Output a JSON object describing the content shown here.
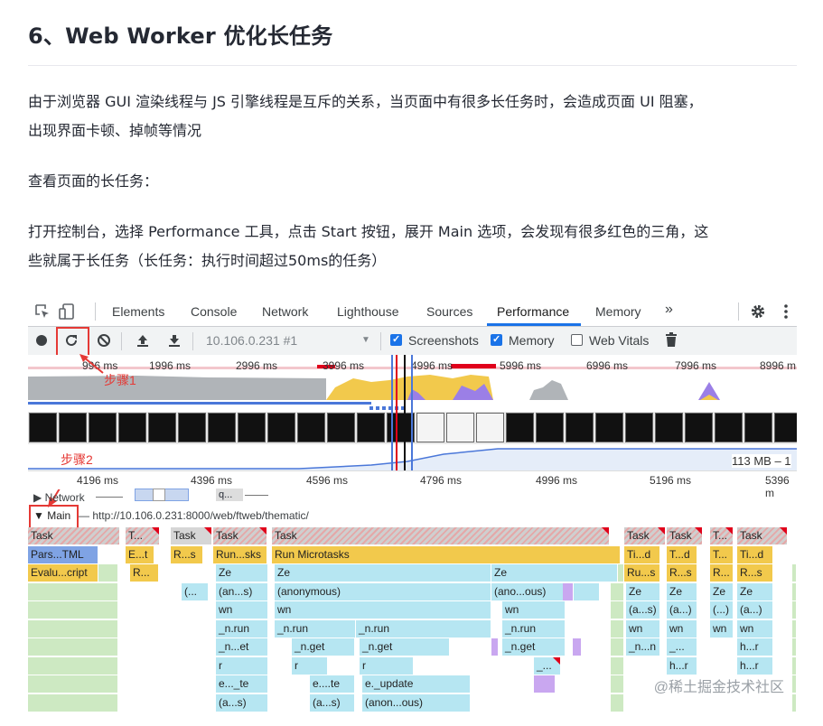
{
  "article": {
    "heading": "6、Web Worker 优化长任务",
    "para1_line1": "由于浏览器 GUI 渲染线程与 JS 引擎线程是互斥的关系，当页面中有很多长任务时，会造成页面 UI 阻塞，",
    "para1_line2": "出现界面卡顿、掉帧等情况",
    "para2": "查看页面的长任务：",
    "para3_line1": "打开控制台，选择 Performance 工具，点击 Start 按钮，展开 Main 选项，会发现有很多红色的三角，这",
    "para3_line2": "些就属于长任务（长任务：执行时间超过50ms的任务）"
  },
  "devtools": {
    "tabs": [
      "Elements",
      "Console",
      "Network",
      "Lighthouse",
      "Sources",
      "Performance",
      "Memory"
    ],
    "active_tab": "Performance",
    "more_tabs": "»",
    "icons": {
      "inspect": "inspect-icon",
      "device": "device-toolbar-icon",
      "settings": "gear-icon",
      "menu": "kebab-icon"
    },
    "toolbar": {
      "record": "record-icon",
      "reload": "reload-icon",
      "clear": "clear-icon",
      "upload": "upload-icon",
      "download": "download-icon",
      "profile": "10.106.0.231 #1",
      "screenshots": "Screenshots",
      "screenshots_checked": true,
      "memory": "Memory",
      "memory_checked": true,
      "webvitals": "Web Vitals",
      "webvitals_checked": false,
      "trash": "trash-icon"
    },
    "annotations": {
      "step1": "步骤1",
      "step2": "步骤2"
    },
    "overview_ruler": [
      "996 ms",
      "1996 ms",
      "2996 ms",
      "3996 ms",
      "4996 ms",
      "5996 ms",
      "6996 ms",
      "7996 ms",
      "8996 m"
    ],
    "memory_readout": "113 MB – 1",
    "detail_ruler": [
      "4196 ms",
      "4396 ms",
      "4596 ms",
      "4796 ms",
      "4996 ms",
      "5196 ms",
      "5396 m"
    ],
    "tracks": {
      "network": "Network",
      "network_item": "q...",
      "main": "Main",
      "main_url": "— http://10.106.0.231:8000/web/ftweb/thematic/"
    },
    "flame_rows": [
      [
        "Task",
        "T...",
        "Task",
        "Task",
        "Task",
        "Task",
        "Task",
        "T...",
        "Task"
      ],
      [
        "Pars...TML",
        "E...t",
        "R...s",
        "Run...sks",
        "Run Microtasks",
        "Ti...d",
        "T...d",
        "T...",
        "Ti...d"
      ],
      [
        "Evalu...cript",
        "R...",
        "Ze",
        "Ze",
        "Ze",
        "Ru...s",
        "R...s",
        "R...",
        "R...s"
      ],
      [
        "(...",
        "(an...s)",
        "(anonymous)",
        "(ano...ous)",
        "Ze",
        "Ze",
        "Ze",
        "Ze"
      ],
      [
        "wn",
        "wn",
        "wn",
        "(a...s)",
        "(a...)",
        "(...)",
        "(a...)"
      ],
      [
        "_n.run",
        "_n.run",
        "_n.run",
        "_n.run",
        "wn",
        "wn",
        "wn",
        "wn"
      ],
      [
        "_n...et",
        "_n.get",
        "_n.get",
        "_n.get",
        "_n...n",
        "_...",
        "h...r"
      ],
      [
        "r",
        "r",
        "r",
        "_...",
        "h...r",
        "h...r"
      ],
      [
        "e..._te",
        "e....te",
        "e._update"
      ],
      [
        "(a...s)",
        "(a...s)",
        "(anon...ous)"
      ]
    ],
    "watermark": "@稀土掘金技术社区"
  }
}
